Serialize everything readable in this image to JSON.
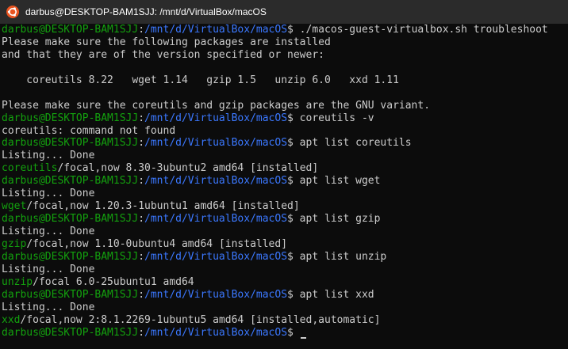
{
  "window": {
    "title": "darbus@DESKTOP-BAM1SJJ: /mnt/d/VirtualBox/macOS",
    "icon": "ubuntu-icon"
  },
  "colors": {
    "green": "#13a10e",
    "blue": "#3b78ff",
    "text": "#cccccc",
    "background": "#0c0c0c",
    "titlebar": "#2b2b2b"
  },
  "terminal": {
    "lines": [
      [
        {
          "t": "darbus@DESKTOP-BAM1SJJ",
          "c": "green"
        },
        {
          "t": ":",
          "c": "white"
        },
        {
          "t": "/mnt/d/VirtualBox/macOS",
          "c": "blue"
        },
        {
          "t": "$ ./macos-guest-virtualbox.sh troubleshoot",
          "c": "white"
        }
      ],
      [
        {
          "t": "Please make sure the following packages are installed",
          "c": "white"
        }
      ],
      [
        {
          "t": "and that they are of the version specified or newer:",
          "c": "white"
        }
      ],
      [
        {
          "t": "",
          "c": "white"
        }
      ],
      [
        {
          "t": "    coreutils 8.22   wget 1.14   gzip 1.5   unzip 6.0   xxd 1.11",
          "c": "white"
        }
      ],
      [
        {
          "t": "",
          "c": "white"
        }
      ],
      [
        {
          "t": "Please make sure the coreutils and gzip packages are the GNU variant.",
          "c": "white"
        }
      ],
      [
        {
          "t": "darbus@DESKTOP-BAM1SJJ",
          "c": "green"
        },
        {
          "t": ":",
          "c": "white"
        },
        {
          "t": "/mnt/d/VirtualBox/macOS",
          "c": "blue"
        },
        {
          "t": "$ coreutils -v",
          "c": "white"
        }
      ],
      [
        {
          "t": "coreutils: command not found",
          "c": "white"
        }
      ],
      [
        {
          "t": "darbus@DESKTOP-BAM1SJJ",
          "c": "green"
        },
        {
          "t": ":",
          "c": "white"
        },
        {
          "t": "/mnt/d/VirtualBox/macOS",
          "c": "blue"
        },
        {
          "t": "$ apt list coreutils",
          "c": "white"
        }
      ],
      [
        {
          "t": "Listing... Done",
          "c": "white"
        }
      ],
      [
        {
          "t": "coreutils",
          "c": "green"
        },
        {
          "t": "/focal,now 8.30-3ubuntu2 amd64 [installed]",
          "c": "white"
        }
      ],
      [
        {
          "t": "darbus@DESKTOP-BAM1SJJ",
          "c": "green"
        },
        {
          "t": ":",
          "c": "white"
        },
        {
          "t": "/mnt/d/VirtualBox/macOS",
          "c": "blue"
        },
        {
          "t": "$ apt list wget",
          "c": "white"
        }
      ],
      [
        {
          "t": "Listing... Done",
          "c": "white"
        }
      ],
      [
        {
          "t": "wget",
          "c": "green"
        },
        {
          "t": "/focal,now 1.20.3-1ubuntu1 amd64 [installed]",
          "c": "white"
        }
      ],
      [
        {
          "t": "darbus@DESKTOP-BAM1SJJ",
          "c": "green"
        },
        {
          "t": ":",
          "c": "white"
        },
        {
          "t": "/mnt/d/VirtualBox/macOS",
          "c": "blue"
        },
        {
          "t": "$ apt list gzip",
          "c": "white"
        }
      ],
      [
        {
          "t": "Listing... Done",
          "c": "white"
        }
      ],
      [
        {
          "t": "gzip",
          "c": "green"
        },
        {
          "t": "/focal,now 1.10-0ubuntu4 amd64 [installed]",
          "c": "white"
        }
      ],
      [
        {
          "t": "darbus@DESKTOP-BAM1SJJ",
          "c": "green"
        },
        {
          "t": ":",
          "c": "white"
        },
        {
          "t": "/mnt/d/VirtualBox/macOS",
          "c": "blue"
        },
        {
          "t": "$ apt list unzip",
          "c": "white"
        }
      ],
      [
        {
          "t": "Listing... Done",
          "c": "white"
        }
      ],
      [
        {
          "t": "unzip",
          "c": "green"
        },
        {
          "t": "/focal 6.0-25ubuntu1 amd64",
          "c": "white"
        }
      ],
      [
        {
          "t": "darbus@DESKTOP-BAM1SJJ",
          "c": "green"
        },
        {
          "t": ":",
          "c": "white"
        },
        {
          "t": "/mnt/d/VirtualBox/macOS",
          "c": "blue"
        },
        {
          "t": "$ apt list xxd",
          "c": "white"
        }
      ],
      [
        {
          "t": "Listing... Done",
          "c": "white"
        }
      ],
      [
        {
          "t": "xxd",
          "c": "green"
        },
        {
          "t": "/focal,now 2:8.1.2269-1ubuntu5 amd64 [installed,automatic]",
          "c": "white"
        }
      ],
      [
        {
          "t": "darbus@DESKTOP-BAM1SJJ",
          "c": "green"
        },
        {
          "t": ":",
          "c": "white"
        },
        {
          "t": "/mnt/d/VirtualBox/macOS",
          "c": "blue"
        },
        {
          "t": "$ ",
          "c": "white"
        }
      ]
    ]
  }
}
